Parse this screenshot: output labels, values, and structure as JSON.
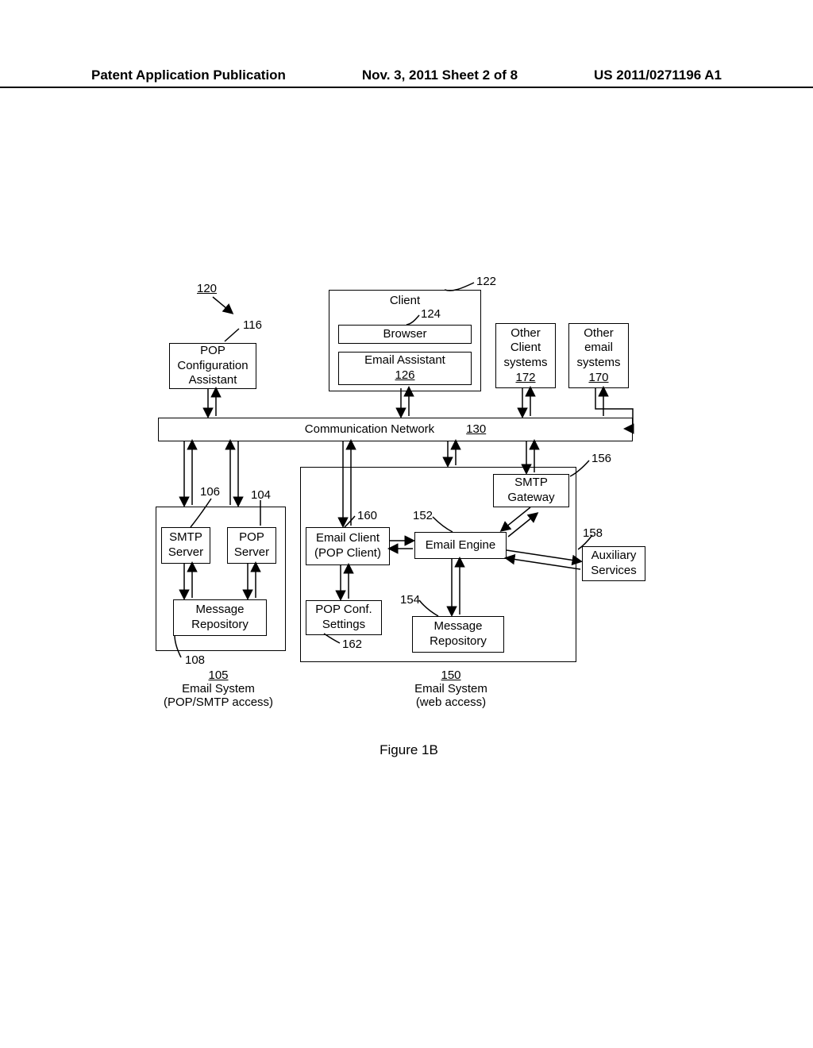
{
  "header": {
    "left": "Patent Application Publication",
    "center": "Nov. 3, 2011   Sheet 2 of 8",
    "right": "US 2011/0271196 A1"
  },
  "labels": {
    "l120": "120",
    "l116": "116",
    "l122": "122",
    "l124": "124",
    "l126": "126",
    "l130": "130",
    "l106": "106",
    "l104": "104",
    "l108": "108",
    "l105": "105",
    "l160": "160",
    "l152": "152",
    "l154": "154",
    "l156": "156",
    "l158": "158",
    "l162": "162",
    "l150": "150",
    "l170": "170",
    "l172": "172"
  },
  "boxes": {
    "pop_conf_asst": "POP\nConfiguration\nAssistant",
    "client": "Client",
    "browser": "Browser",
    "email_asst": "Email Assistant",
    "other_client": "Other\nClient\nsystems",
    "other_email": "Other\nemail\nsystems",
    "comm_net": "Communication Network",
    "smtp_server": "SMTP\nServer",
    "pop_server": "POP\nServer",
    "msg_repo_left": "Message\nRepository",
    "sys_left_title": "Email System\n(POP/SMTP access)",
    "email_client_pop": "Email Client\n(POP Client)",
    "email_engine": "Email Engine",
    "pop_conf_settings": "POP Conf.\nSettings",
    "msg_repo_right": "Message\nRepository",
    "smtp_gateway": "SMTP\nGateway",
    "aux_services": "Auxiliary\nServices",
    "sys_right_title": "Email System\n(web access)"
  },
  "figure": "Figure 1B"
}
